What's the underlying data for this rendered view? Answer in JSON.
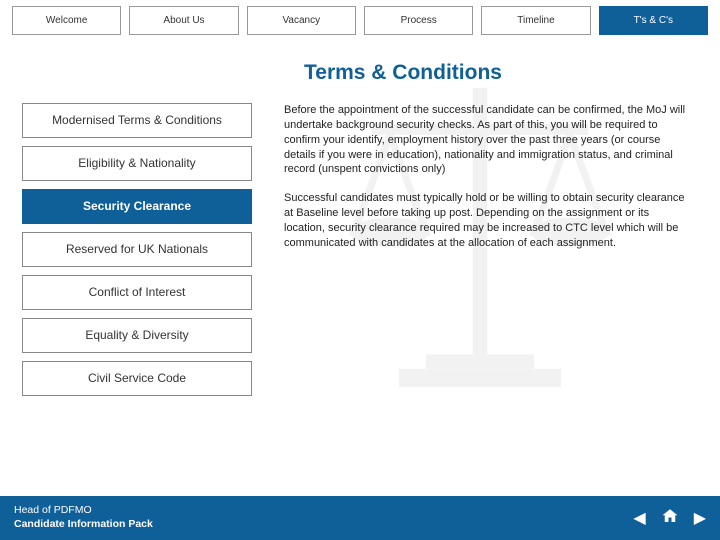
{
  "topnav": {
    "items": [
      {
        "label": "Welcome",
        "active": false
      },
      {
        "label": "About Us",
        "active": false
      },
      {
        "label": "Vacancy",
        "active": false
      },
      {
        "label": "Process",
        "active": false
      },
      {
        "label": "Timeline",
        "active": false
      },
      {
        "label": "T's & C's",
        "active": true
      }
    ]
  },
  "page_title": "Terms & Conditions",
  "sidebar": {
    "items": [
      {
        "label": "Modernised Terms & Conditions",
        "active": false
      },
      {
        "label": "Eligibility & Nationality",
        "active": false
      },
      {
        "label": "Security Clearance",
        "active": true
      },
      {
        "label": "Reserved for UK Nationals",
        "active": false
      },
      {
        "label": "Conflict of Interest",
        "active": false
      },
      {
        "label": "Equality & Diversity",
        "active": false
      },
      {
        "label": "Civil Service Code",
        "active": false
      }
    ]
  },
  "main": {
    "p1": "Before the appointment of the successful candidate can be confirmed, the MoJ will undertake background security checks. As part of this, you will be required to confirm your identify, employment history over the past three years (or course details if you were in education), nationality and immigration status, and criminal record (unspent convictions only)",
    "p2": "Successful candidates must typically hold or be willing to obtain security clearance at Baseline level before taking up post. Depending on the assignment or its location, security clearance required may be increased to CTC level which will be communicated with candidates at the allocation of each assignment."
  },
  "footer": {
    "line1": "Head of PDFMO",
    "line2": "Candidate Information Pack"
  }
}
